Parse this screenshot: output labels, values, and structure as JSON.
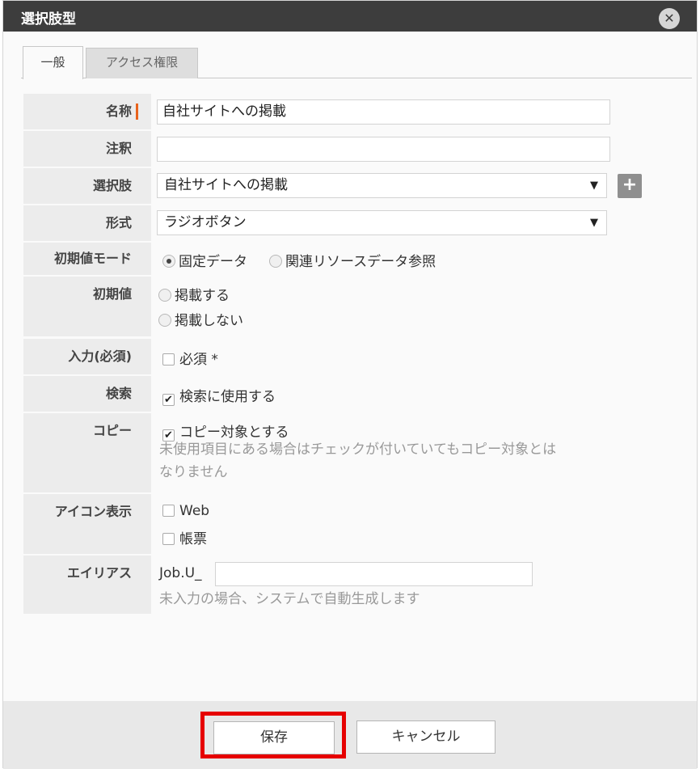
{
  "dialog": {
    "title": "選択肢型",
    "close_icon": "close-icon",
    "close_glyph": "✕"
  },
  "tabs": [
    {
      "label": "一般",
      "active": true
    },
    {
      "label": "アクセス権限",
      "active": false
    }
  ],
  "form": {
    "name": {
      "label": "名称",
      "value": "自社サイトへの掲載"
    },
    "note": {
      "label": "注釈",
      "value": ""
    },
    "choice": {
      "label": "選択肢",
      "selected": "自社サイトへの掲載",
      "add_glyph": "+"
    },
    "format": {
      "label": "形式",
      "selected": "ラジオボタン"
    },
    "initial_mode": {
      "label": "初期値モード",
      "options": [
        "固定データ",
        "関連リソースデータ参照"
      ],
      "selected": "固定データ"
    },
    "initial_value": {
      "label": "初期値",
      "options": [
        "掲載する",
        "掲載しない"
      ]
    },
    "required": {
      "label": "入力(必須)",
      "option": "必須 *",
      "checked": false
    },
    "search": {
      "label": "検索",
      "option": "検索に使用する",
      "checked": true
    },
    "copy": {
      "label": "コピー",
      "option": "コピー対象とする",
      "checked": true,
      "hint_line1": "未使用項目にある場合はチェックが付いていてもコピー対象とは",
      "hint_line2": "なりません"
    },
    "icon_display": {
      "label": "アイコン表示",
      "options": [
        {
          "label": "Web",
          "checked": false
        },
        {
          "label": "帳票",
          "checked": false
        }
      ]
    },
    "alias": {
      "label": "エイリアス",
      "prefix": "Job.U_",
      "value": "",
      "hint": "未入力の場合、システムで自動生成します"
    }
  },
  "footer": {
    "save_label": "保存",
    "cancel_label": "キャンセル"
  },
  "colors": {
    "titlebar": "#3d3d3d",
    "required_marker": "#e8631c",
    "highlight": "#e60000"
  },
  "dropdown_glyph": "▼",
  "check_glyph": "✔"
}
